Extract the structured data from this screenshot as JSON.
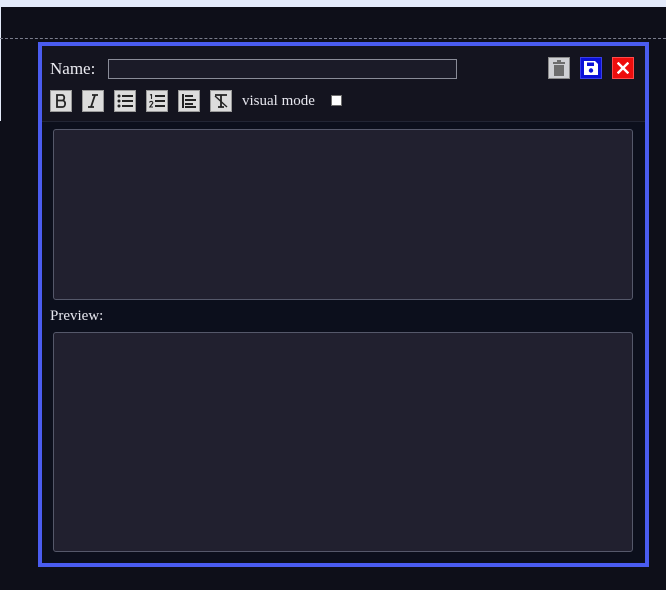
{
  "editor": {
    "name_label": "Name:",
    "name_value": "",
    "visual_mode_label": "visual mode",
    "visual_mode_checked": false,
    "preview_label": "Preview:",
    "text_content": "",
    "preview_content": "",
    "actions": [
      {
        "id": "delete",
        "icon": "trash-icon"
      },
      {
        "id": "save",
        "icon": "floppy-disk-icon"
      },
      {
        "id": "close",
        "icon": "close-x-icon"
      }
    ],
    "format_buttons": [
      {
        "id": "bold",
        "icon": "bold-icon"
      },
      {
        "id": "italic",
        "icon": "italic-icon"
      },
      {
        "id": "bullet-list",
        "icon": "unordered-list-icon"
      },
      {
        "id": "numbered-list",
        "icon": "ordered-list-icon"
      },
      {
        "id": "align-left",
        "icon": "align-left-icon"
      },
      {
        "id": "clear-format",
        "icon": "clear-formatting-icon"
      }
    ]
  },
  "colors": {
    "accent_border": "#4a5cf0",
    "save_button": "#0a10d8",
    "close_button": "#ee0d0d",
    "page_background": "#0e0f19"
  }
}
